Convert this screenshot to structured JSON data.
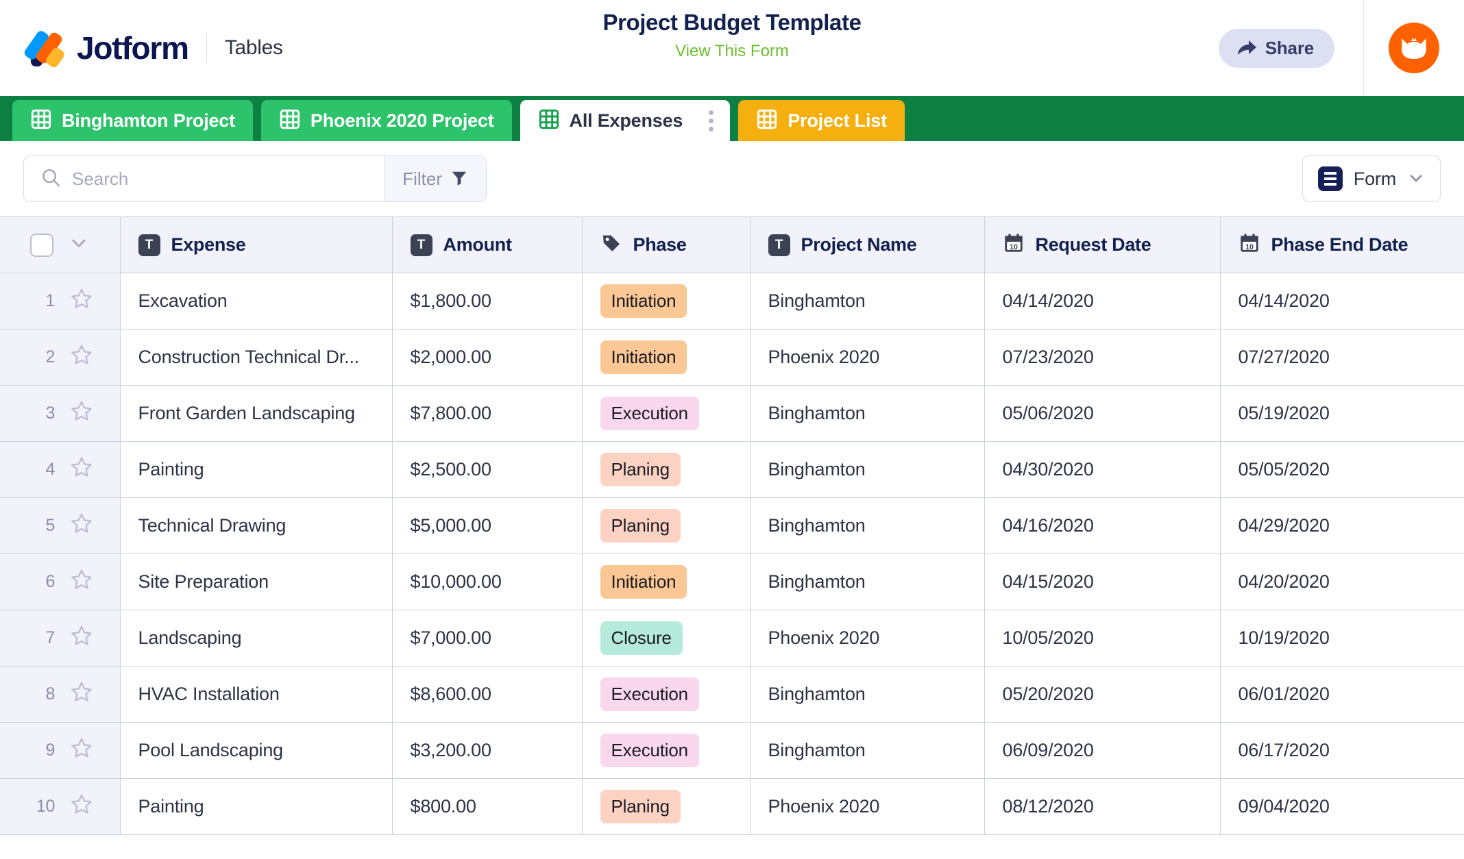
{
  "header": {
    "brand_name": "Jotform",
    "product_label": "Tables",
    "form_title": "Project Budget Template",
    "form_sublink": "View This Form",
    "share_label": "Share",
    "share_icon": "share-arrow-icon",
    "avatar_icon": "user-avatar-cat-icon"
  },
  "tabs": [
    {
      "label": "Binghamton Project",
      "icon": "grid-table-icon",
      "style": "green",
      "active": false,
      "has_menu": false
    },
    {
      "label": "Phoenix 2020 Project",
      "icon": "grid-table-icon",
      "style": "green",
      "active": false,
      "has_menu": false
    },
    {
      "label": "All Expenses",
      "icon": "grid-table-icon",
      "style": "active",
      "active": true,
      "has_menu": true
    },
    {
      "label": "Project List",
      "icon": "grid-table-icon",
      "style": "amber",
      "active": false,
      "has_menu": false
    }
  ],
  "toolbar": {
    "search_placeholder": "Search",
    "search_value": "",
    "search_icon": "search-icon",
    "filter_label": "Filter",
    "filter_icon": "funnel-icon",
    "view_label": "Form",
    "view_icon": "form-icon",
    "view_chevron": "chevron-down-icon"
  },
  "table": {
    "columns": [
      {
        "label": "Expense",
        "type_icon": "text-field-icon",
        "glyph": "T"
      },
      {
        "label": "Amount",
        "type_icon": "text-field-icon",
        "glyph": "T"
      },
      {
        "label": "Phase",
        "type_icon": "tag-icon",
        "glyph": ""
      },
      {
        "label": "Project Name",
        "type_icon": "text-field-icon",
        "glyph": "T"
      },
      {
        "label": "Request Date",
        "type_icon": "calendar-icon",
        "glyph": "10"
      },
      {
        "label": "Phase End Date",
        "type_icon": "calendar-icon",
        "glyph": "10"
      }
    ],
    "rows": [
      {
        "n": "1",
        "expense": "Excavation",
        "amount": "$1,800.00",
        "phase": "Initiation",
        "project": "Binghamton",
        "request_date": "04/14/2020",
        "phase_end_date": "04/14/2020"
      },
      {
        "n": "2",
        "expense": "Construction Technical Dr...",
        "amount": "$2,000.00",
        "phase": "Initiation",
        "project": "Phoenix 2020",
        "request_date": "07/23/2020",
        "phase_end_date": "07/27/2020"
      },
      {
        "n": "3",
        "expense": "Front Garden Landscaping",
        "amount": "$7,800.00",
        "phase": "Execution",
        "project": "Binghamton",
        "request_date": "05/06/2020",
        "phase_end_date": "05/19/2020"
      },
      {
        "n": "4",
        "expense": "Painting",
        "amount": "$2,500.00",
        "phase": "Planing",
        "project": "Binghamton",
        "request_date": "04/30/2020",
        "phase_end_date": "05/05/2020"
      },
      {
        "n": "5",
        "expense": "Technical Drawing",
        "amount": "$5,000.00",
        "phase": "Planing",
        "project": "Binghamton",
        "request_date": "04/16/2020",
        "phase_end_date": "04/29/2020"
      },
      {
        "n": "6",
        "expense": "Site Preparation",
        "amount": "$10,000.00",
        "phase": "Initiation",
        "project": "Binghamton",
        "request_date": "04/15/2020",
        "phase_end_date": "04/20/2020"
      },
      {
        "n": "7",
        "expense": "Landscaping",
        "amount": "$7,000.00",
        "phase": "Closure",
        "project": "Phoenix 2020",
        "request_date": "10/05/2020",
        "phase_end_date": "10/19/2020"
      },
      {
        "n": "8",
        "expense": "HVAC Installation",
        "amount": "$8,600.00",
        "phase": "Execution",
        "project": "Binghamton",
        "request_date": "05/20/2020",
        "phase_end_date": "06/01/2020"
      },
      {
        "n": "9",
        "expense": "Pool Landscaping",
        "amount": "$3,200.00",
        "phase": "Execution",
        "project": "Binghamton",
        "request_date": "06/09/2020",
        "phase_end_date": "06/17/2020"
      },
      {
        "n": "10",
        "expense": "Painting",
        "amount": "$800.00",
        "phase": "Planing",
        "project": "Phoenix 2020",
        "request_date": "08/12/2020",
        "phase_end_date": "09/04/2020"
      }
    ]
  },
  "colors": {
    "brand_navy": "#0A1551",
    "tabbar_green": "#0E8043",
    "tab_green": "#2DC36B",
    "tab_amber": "#F5AF0E",
    "sublink_green": "#6CBF2E",
    "avatar_orange": "#FF6100",
    "header_row_bg": "#F1F2FA",
    "phase_initiation": "#FAC795",
    "phase_execution": "#F9D7EC",
    "phase_planing": "#FCD2C3",
    "phase_closure": "#B6EBDC"
  }
}
